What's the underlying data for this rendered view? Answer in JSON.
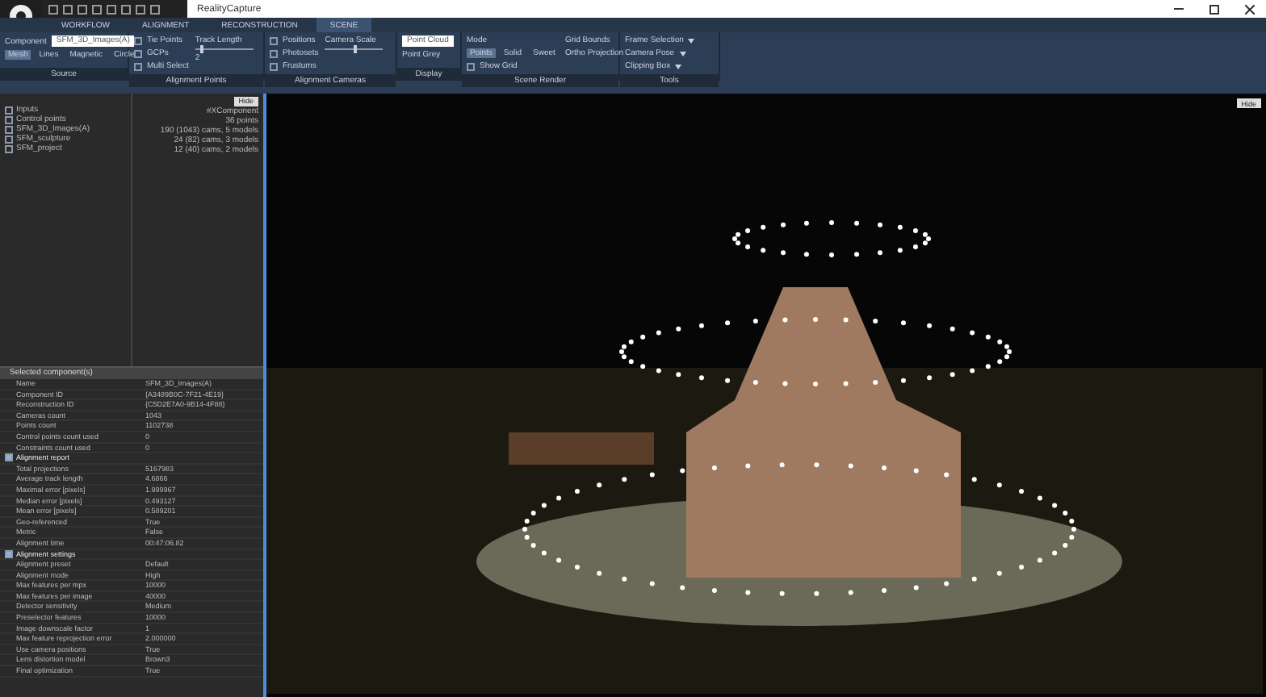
{
  "window": {
    "title": "RealityCapture"
  },
  "tabs": [
    {
      "label": "WORKFLOW",
      "selected": false
    },
    {
      "label": "ALIGNMENT",
      "selected": false
    },
    {
      "label": "RECONSTRUCTION",
      "selected": false
    },
    {
      "label": "SCENE",
      "selected": true
    }
  ],
  "ribbon": {
    "source": {
      "label": "Component",
      "value": "SFM_3D_Images(A)",
      "modes": [
        {
          "label": "Mesh",
          "selected": true
        },
        {
          "label": "Lines",
          "selected": false
        },
        {
          "label": "Magnetic",
          "selected": false
        },
        {
          "label": "Circle",
          "selected": false
        }
      ]
    },
    "alignment_points": {
      "checks": [
        {
          "label": "Tie Points",
          "checked": false
        },
        {
          "label": "GCPs",
          "checked": false
        },
        {
          "label": "Multi Select",
          "checked": false
        }
      ],
      "slider_label": "Track Length",
      "level": 0.1,
      "value": "2"
    },
    "alignment_cameras": {
      "checks": [
        {
          "label": "Positions",
          "checked": false
        },
        {
          "label": "Photosets",
          "checked": false
        },
        {
          "label": "Frustums",
          "checked": false
        }
      ],
      "slider_label": "Camera Scale",
      "level": 0.5
    },
    "display": {
      "value": "Point Cloud",
      "option": "Point Grey"
    },
    "scene_render": {
      "label": "Mode",
      "modes": [
        {
          "label": "Points",
          "selected": true
        },
        {
          "label": "Solid",
          "selected": false
        },
        {
          "label": "Sweet",
          "selected": false
        }
      ],
      "show_grid": {
        "label": "Show Grid",
        "checked": false
      },
      "grid_bounds": "Grid Bounds",
      "ortho": "Ortho Projection"
    },
    "tools": [
      "Frame Selection",
      "Camera Pose",
      "Clipping Box"
    ],
    "sections": [
      "Source",
      "Alignment Points",
      "Alignment Cameras",
      "Display",
      "Scene Render",
      "Tools"
    ]
  },
  "tree": {
    "button": "Hide",
    "items": [
      {
        "name": "Inputs",
        "info": "#XComponent"
      },
      {
        "name": "Control points",
        "info": "36 points"
      },
      {
        "name": "SFM_3D_Images(A)",
        "info": "190 (1043) cams, 5 models"
      },
      {
        "name": "SFM_sculpture",
        "info": "24 (82) cams, 3 models"
      },
      {
        "name": "SFM_project",
        "info": "12 (40) cams, 2 models"
      }
    ]
  },
  "properties": {
    "title": "Selected component(s)",
    "rows": [
      {
        "kind": "row",
        "name": "Name",
        "value": "SFM_3D_Images(A)"
      },
      {
        "kind": "row",
        "name": "Component ID",
        "value": "{A3489B0C-7F21-4E19}"
      },
      {
        "kind": "row",
        "name": "Reconstruction ID",
        "value": "{C5D2E7A0-9B14-4F88}"
      },
      {
        "kind": "row",
        "name": "Cameras count",
        "value": "1043"
      },
      {
        "kind": "row",
        "name": "Points count",
        "value": "1102738"
      },
      {
        "kind": "row",
        "name": "Control points count used",
        "value": "0"
      },
      {
        "kind": "row",
        "name": "Constraints count used",
        "value": "0"
      },
      {
        "kind": "group",
        "name": "Alignment report"
      },
      {
        "kind": "row",
        "name": "Total projections",
        "value": "5167983"
      },
      {
        "kind": "row",
        "name": "Average track length",
        "value": "4.6866"
      },
      {
        "kind": "row",
        "name": "Maximal error [pixels]",
        "value": "1.999967"
      },
      {
        "kind": "row",
        "name": "Median error [pixels]",
        "value": "0.493127"
      },
      {
        "kind": "row",
        "name": "Mean error [pixels]",
        "value": "0.589201"
      },
      {
        "kind": "row",
        "name": "Geo-referenced",
        "value": "True"
      },
      {
        "kind": "row",
        "name": "Metric",
        "value": "False"
      },
      {
        "kind": "row",
        "name": "Alignment time",
        "value": "00:47:06.82"
      },
      {
        "kind": "group",
        "name": "Alignment settings"
      },
      {
        "kind": "row",
        "name": "Alignment preset",
        "value": "Default"
      },
      {
        "kind": "row",
        "name": "Alignment mode",
        "value": "High"
      },
      {
        "kind": "row",
        "name": "Max features per mpx",
        "value": "10000"
      },
      {
        "kind": "row",
        "name": "Max features per image",
        "value": "40000"
      },
      {
        "kind": "row",
        "name": "Detector sensitivity",
        "value": "Medium"
      },
      {
        "kind": "row",
        "name": "Preselector features",
        "value": "10000"
      },
      {
        "kind": "row",
        "name": "Image downscale factor",
        "value": "1"
      },
      {
        "kind": "row",
        "name": "Max feature reprojection error",
        "value": "2.000000"
      },
      {
        "kind": "row",
        "name": "Use camera positions",
        "value": "True"
      },
      {
        "kind": "row",
        "name": "Lens distortion model",
        "value": "Brown3"
      },
      {
        "kind": "row",
        "name": "Final optimization",
        "value": "True"
      }
    ]
  },
  "viewport": {
    "button": "Hide"
  }
}
